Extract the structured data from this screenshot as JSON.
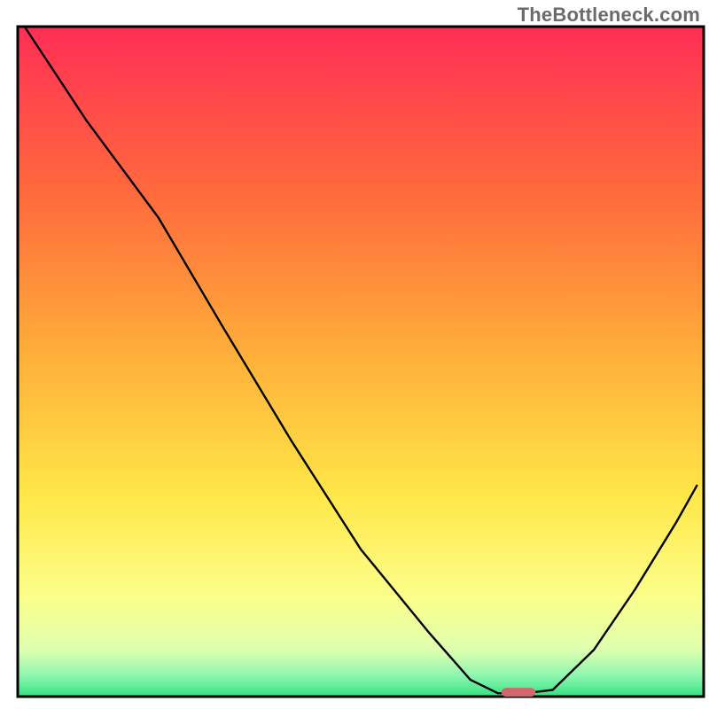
{
  "watermark": "TheBottleneck.com",
  "chart_data": {
    "type": "line",
    "title": "",
    "xlabel": "",
    "ylabel": "",
    "x_range": [
      0,
      100
    ],
    "y_range": [
      0,
      100
    ],
    "grid": false,
    "legend": false,
    "background_gradient": {
      "stops": [
        {
          "offset": 0.0,
          "color": "#ff2e55"
        },
        {
          "offset": 0.25,
          "color": "#ff6a3c"
        },
        {
          "offset": 0.5,
          "color": "#ffb23a"
        },
        {
          "offset": 0.7,
          "color": "#ffe748"
        },
        {
          "offset": 0.85,
          "color": "#fcff8a"
        },
        {
          "offset": 0.93,
          "color": "#dfffb0"
        },
        {
          "offset": 0.97,
          "color": "#8bf7af"
        },
        {
          "offset": 1.0,
          "color": "#33e07f"
        }
      ]
    },
    "series": [
      {
        "name": "bottleneck-curve",
        "color": "#000000",
        "width": 2.4,
        "points": [
          {
            "x": 1.0,
            "y": 100.0
          },
          {
            "x": 10.0,
            "y": 86.0
          },
          {
            "x": 20.5,
            "y": 71.5
          },
          {
            "x": 30.0,
            "y": 55.0
          },
          {
            "x": 40.0,
            "y": 38.0
          },
          {
            "x": 50.0,
            "y": 22.0
          },
          {
            "x": 60.0,
            "y": 9.5
          },
          {
            "x": 66.0,
            "y": 2.5
          },
          {
            "x": 70.0,
            "y": 0.5
          },
          {
            "x": 74.0,
            "y": 0.5
          },
          {
            "x": 78.0,
            "y": 1.0
          },
          {
            "x": 84.0,
            "y": 7.0
          },
          {
            "x": 90.0,
            "y": 16.0
          },
          {
            "x": 96.0,
            "y": 26.0
          },
          {
            "x": 99.0,
            "y": 31.5
          }
        ]
      }
    ],
    "marker": {
      "name": "optimal-point",
      "x": 73.0,
      "y": 0.7,
      "width_x": 5.0,
      "height_y": 1.2,
      "color": "#d1666b"
    }
  }
}
